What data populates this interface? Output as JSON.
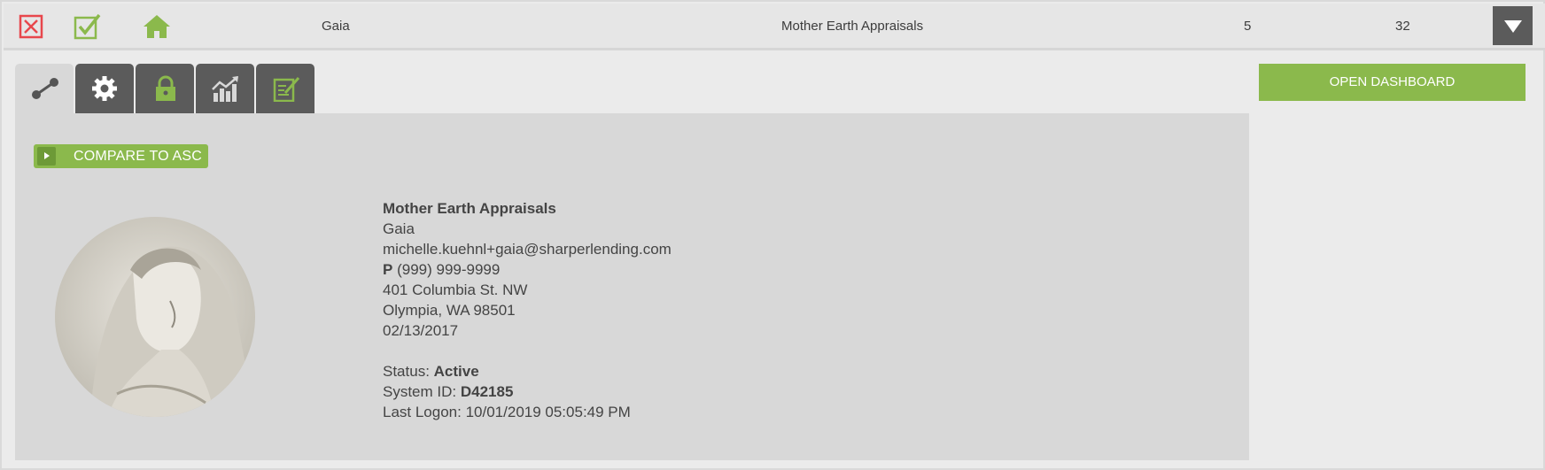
{
  "row": {
    "name": "Gaia",
    "company": "Mother Earth Appraisals",
    "count_a": "5",
    "count_b": "32"
  },
  "icons": {
    "delete": "close-box-icon",
    "approve": "checkbox-checked-icon",
    "home": "home-icon",
    "expand": "caret-down-icon"
  },
  "tabs": [
    {
      "name": "connection-icon",
      "active": true
    },
    {
      "name": "gear-icon",
      "active": false
    },
    {
      "name": "lock-icon",
      "active": false
    },
    {
      "name": "chart-icon",
      "active": false
    },
    {
      "name": "notes-icon",
      "active": false
    }
  ],
  "compare_button": "COMPARE TO ASC",
  "open_dashboard": "OPEN DASHBOARD",
  "profile": {
    "company": "Mother Earth Appraisals",
    "name": "Gaia",
    "email": "michelle.kuehnl+gaia@sharperlending.com",
    "phone_label": "P",
    "phone": "(999) 999-9999",
    "address1": "401 Columbia St. NW",
    "address2": "Olympia, WA 98501",
    "date": "02/13/2017",
    "status_label": "Status:",
    "status": "Active",
    "system_id_label": "System ID:",
    "system_id": "D42185",
    "last_logon_label": "Last Logon:",
    "last_logon": "10/01/2019 05:05:49 PM"
  },
  "colors": {
    "accent_green": "#8bb94c",
    "delete_red": "#e8474c",
    "dark_tab": "#5b5b5b",
    "panel": "#d8d8d8"
  }
}
